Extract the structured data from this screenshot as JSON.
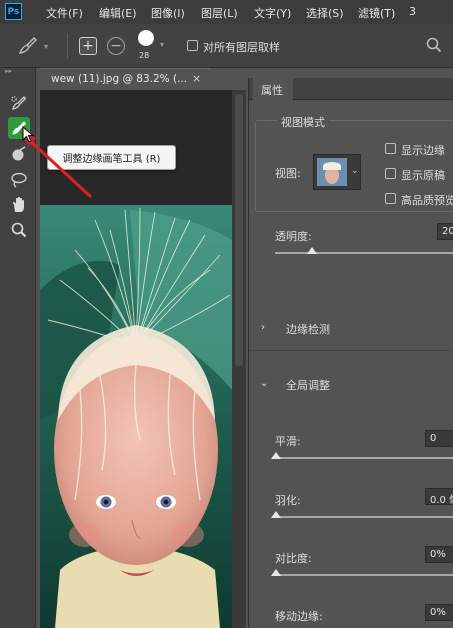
{
  "app": {
    "logo": "Ps"
  },
  "menu": {
    "items": [
      "文件(F)",
      "编辑(E)",
      "图像(I)",
      "图层(L)",
      "文字(Y)",
      "选择(S)",
      "滤镜(T)",
      "3"
    ]
  },
  "options_bar": {
    "brush_size": "28",
    "sample_all_layers": "对所有图层取样"
  },
  "document": {
    "tab_title": "wew (11).jpg @ 83.2% (..."
  },
  "tooltip": {
    "text": "调整边缘画笔工具 (R)"
  },
  "panel": {
    "tab": "属性",
    "view_mode": {
      "title": "视图模式",
      "view_label": "视图:",
      "show_edges": "显示边缘",
      "show_original": "显示原稿",
      "high_quality_preview": "高品质预览"
    },
    "opacity": {
      "label": "透明度:",
      "value": "20"
    },
    "edge_detection": {
      "title": "边缘检测"
    },
    "global_refinement": {
      "title": "全局调整",
      "smooth": {
        "label": "平滑:",
        "value": "0"
      },
      "feather": {
        "label": "羽化:",
        "value": "0.0 像"
      },
      "contrast": {
        "label": "对比度:",
        "value": "0%"
      },
      "shift_edge": {
        "label": "移动边缘:",
        "value": "0%"
      }
    }
  },
  "colors": {
    "accent_tool": "#2e9b3f",
    "arrow": "#e02020",
    "ps_blue": "#31a8ff"
  }
}
